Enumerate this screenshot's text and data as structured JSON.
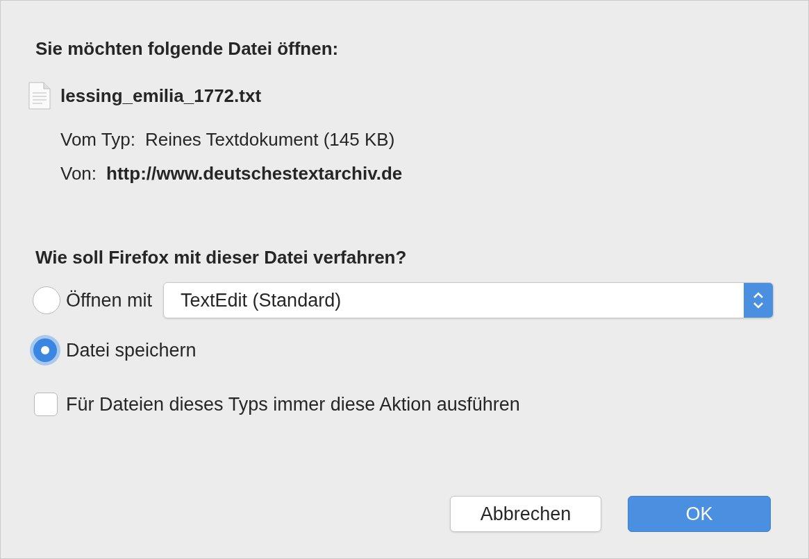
{
  "prompt": "Sie möchten folgende Datei öffnen:",
  "file": {
    "name": "lessing_emilia_1772.txt",
    "details": [
      {
        "label": "Vom Typ:",
        "value": "Reines Textdokument (145 KB)",
        "bold": false
      },
      {
        "label": "Von:",
        "value": "http://www.deutschestextarchiv.de",
        "bold": true
      }
    ]
  },
  "question": "Wie soll Firefox mit dieser Datei verfahren?",
  "options": [
    {
      "kind": "app",
      "label": "Öffnen mit",
      "selected": false,
      "app": "TextEdit (Standard)"
    },
    {
      "kind": "plain",
      "label": "Datei speichern",
      "selected": true
    }
  ],
  "remember": {
    "label": "Für Dateien dieses Typs immer diese Aktion ausführen",
    "checked": false
  },
  "buttons": [
    {
      "label": "Abbrechen",
      "default": false
    },
    {
      "label": "OK",
      "default": true
    }
  ]
}
